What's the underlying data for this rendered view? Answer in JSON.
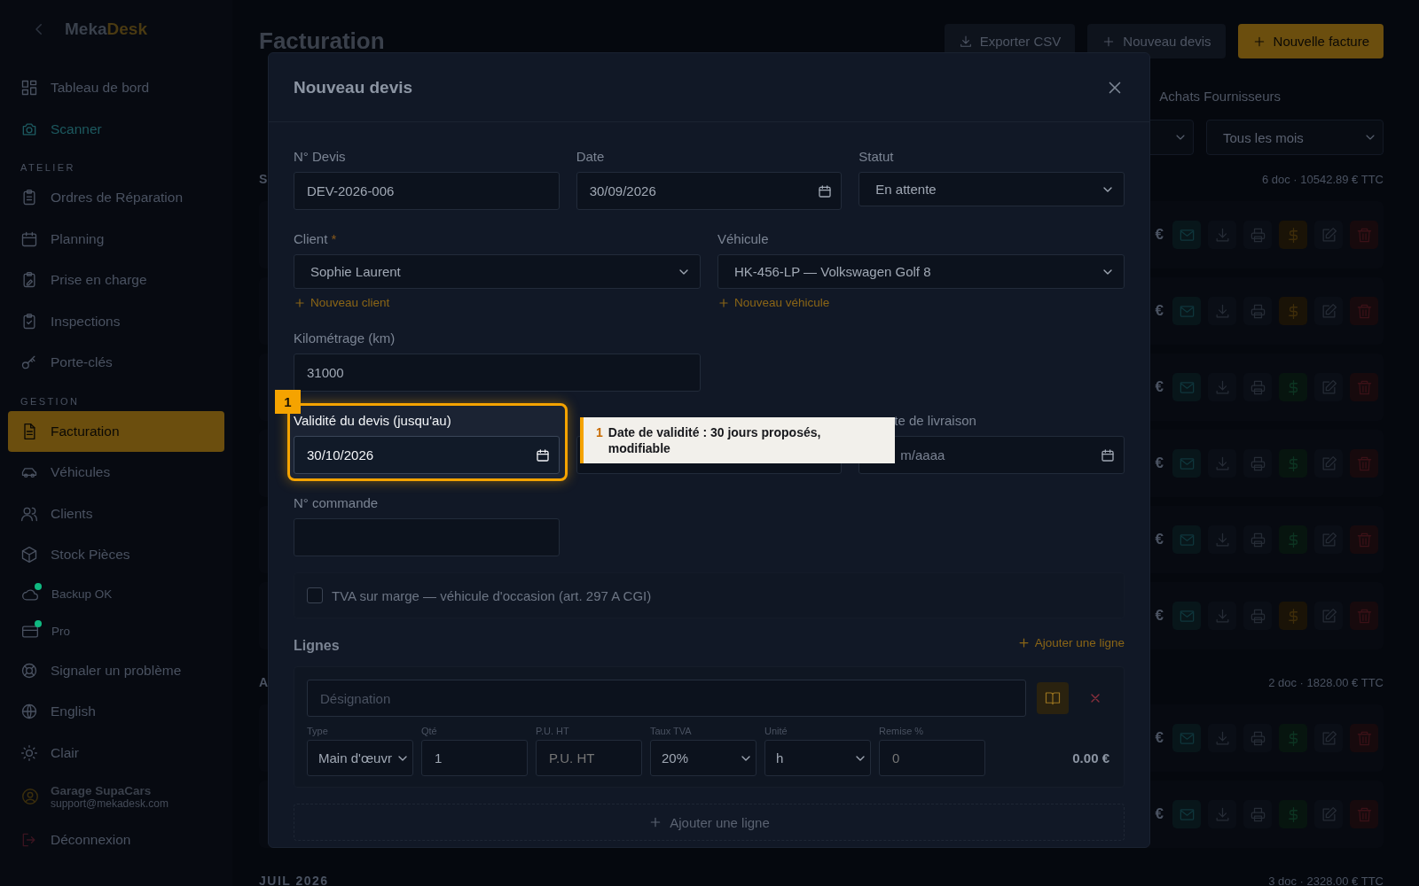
{
  "sidebar": {
    "logo": {
      "first": "Meka",
      "second": "Desk"
    },
    "groups": [
      {
        "items": [
          {
            "label": "Tableau de bord",
            "selected": false,
            "kind": "nav"
          },
          {
            "label": "Scanner",
            "selected": false,
            "kind": "accent"
          }
        ]
      },
      {
        "heading": "ATELIER",
        "items": [
          {
            "label": "Ordres de Réparation",
            "selected": false,
            "kind": "nav"
          },
          {
            "label": "Planning",
            "selected": false,
            "kind": "nav"
          },
          {
            "label": "Prise en charge",
            "selected": false,
            "kind": "nav"
          },
          {
            "label": "Inspections",
            "selected": false,
            "kind": "nav"
          },
          {
            "label": "Porte-clés",
            "selected": false,
            "kind": "nav"
          }
        ]
      },
      {
        "heading": "GESTION",
        "items": [
          {
            "label": "Facturation",
            "selected": true,
            "kind": "nav"
          },
          {
            "label": "Véhicules",
            "selected": false,
            "kind": "nav"
          },
          {
            "label": "Clients",
            "selected": false,
            "kind": "nav"
          },
          {
            "label": "Stock Pièces",
            "selected": false,
            "kind": "nav"
          }
        ]
      }
    ],
    "status": [
      {
        "label": "Backup OK",
        "color": "#10b981"
      },
      {
        "label": "Pro",
        "color": "#10b981"
      }
    ],
    "links": [
      "Signaler un problème",
      "English",
      "Clair"
    ],
    "account": {
      "name": "Garage SupaCars",
      "email": "support@mekadesk.com"
    },
    "logout": "Déconnexion"
  },
  "page": {
    "title": "Facturation",
    "actions": [
      {
        "label": "Exporter CSV",
        "kind": "export"
      },
      {
        "label": "Nouveau devis",
        "kind": "secondary"
      },
      {
        "label": "Nouvelle facture",
        "kind": "primary"
      }
    ],
    "tabs": [
      {
        "label": "Achats Fournisseurs",
        "selected": false
      }
    ],
    "filters": [
      {
        "kind": "select"
      },
      {
        "kind": "select",
        "value": "Tous les mois"
      }
    ],
    "groups": [
      {
        "title": "S",
        "summary": "6 doc · 10542.89 € TTC",
        "rows": [
          {
            "amount": "€",
            "paid": false
          },
          {
            "amount": "€",
            "paid": false
          },
          {
            "amount": "€",
            "paid": true
          },
          {
            "amount": "€",
            "paid": true
          },
          {
            "amount": "€",
            "paid": true
          },
          {
            "amount": "€",
            "paid": false
          }
        ]
      },
      {
        "title": "A",
        "summary": "2 doc · 1828.00 € TTC",
        "rows": [
          {
            "amount": "€",
            "paid": true
          },
          {
            "amount": "€",
            "paid": true
          }
        ]
      },
      {
        "title": "JUIL 2026",
        "summary": "3 doc · 2328.00 € TTC"
      }
    ]
  },
  "modal": {
    "title": "Nouveau devis",
    "rows": [
      [
        {
          "label": "N° Devis",
          "kind": "text",
          "value": "DEV-2026-006"
        },
        {
          "label": "Date",
          "kind": "date",
          "value": "30/09/2026"
        },
        {
          "label": "Statut",
          "kind": "select",
          "value": "En attente"
        }
      ],
      [
        {
          "label": "Client",
          "required_mark": "*",
          "kind": "select",
          "value": "Sophie Laurent",
          "link": "Nouveau client"
        },
        {
          "label": "Véhicule",
          "kind": "select",
          "value": "HK-456-LP — Volkswagen Golf 8",
          "link": "Nouveau véhicule"
        }
      ],
      [
        {
          "label": "Kilométrage (km)",
          "kind": "text",
          "value": "31000"
        }
      ],
      [
        {
          "label": "Validité du devis (jusqu'au)",
          "kind": "date",
          "value": "30/10/2026",
          "highlighted": true
        },
        {
          "kind": "date"
        },
        {
          "label": "te de livraison",
          "kind": "date",
          "placeholder": "m/aaaa",
          "cut": true
        }
      ],
      [
        {
          "label": "N° commande",
          "kind": "text"
        }
      ]
    ],
    "checkbox": {
      "label": "TVA sur marge — véhicule d'occasion (art. 297 A CGI)",
      "checked": false
    },
    "lines": {
      "title": "Lignes",
      "add_link": "Ajouter une ligne",
      "items": [
        {
          "designation_placeholder": "Désignation",
          "fields": [
            {
              "label": "Type",
              "kind": "select",
              "value": "Main d'œuvr"
            },
            {
              "label": "Qté",
              "kind": "text",
              "value": "1"
            },
            {
              "label": "P.U. HT",
              "kind": "text",
              "placeholder": "P.U. HT"
            },
            {
              "label": "Taux TVA",
              "kind": "select",
              "value": "20%"
            },
            {
              "label": "Unité",
              "kind": "select",
              "value": "h"
            },
            {
              "label": "Remise %",
              "kind": "text",
              "placeholder": "0"
            }
          ],
          "total": "0.00 €"
        }
      ],
      "add_button": "Ajouter une ligne"
    },
    "annotation": {
      "badge": "1",
      "number": "1",
      "text": "Date de validité : 30 jours proposés, modifiable"
    }
  }
}
